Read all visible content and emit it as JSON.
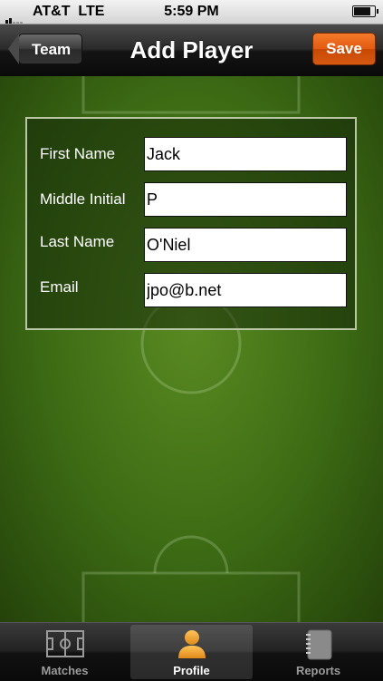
{
  "status_bar": {
    "carrier": "AT&T",
    "network": "LTE",
    "time": "5:59 PM",
    "battery_level": 0.9
  },
  "nav_bar": {
    "title": "Add Player",
    "back_label": "Team",
    "save_label": "Save"
  },
  "form": {
    "fields": [
      {
        "label": "First Name",
        "value": "Jack"
      },
      {
        "label": "Middle Initial",
        "value": "P"
      },
      {
        "label": "Last Name",
        "value": "O'Niel"
      },
      {
        "label": "Email",
        "value": "jpo@b.net"
      }
    ]
  },
  "tab_bar": {
    "tabs": [
      {
        "label": "Matches",
        "icon": "soccer-field-icon",
        "active": false
      },
      {
        "label": "Profile",
        "icon": "person-icon",
        "active": true
      },
      {
        "label": "Reports",
        "icon": "notebook-icon",
        "active": false
      }
    ]
  },
  "colors": {
    "accent": "#e2600f",
    "field_green": "#3c6a14",
    "active_icon": "#f0a030"
  }
}
